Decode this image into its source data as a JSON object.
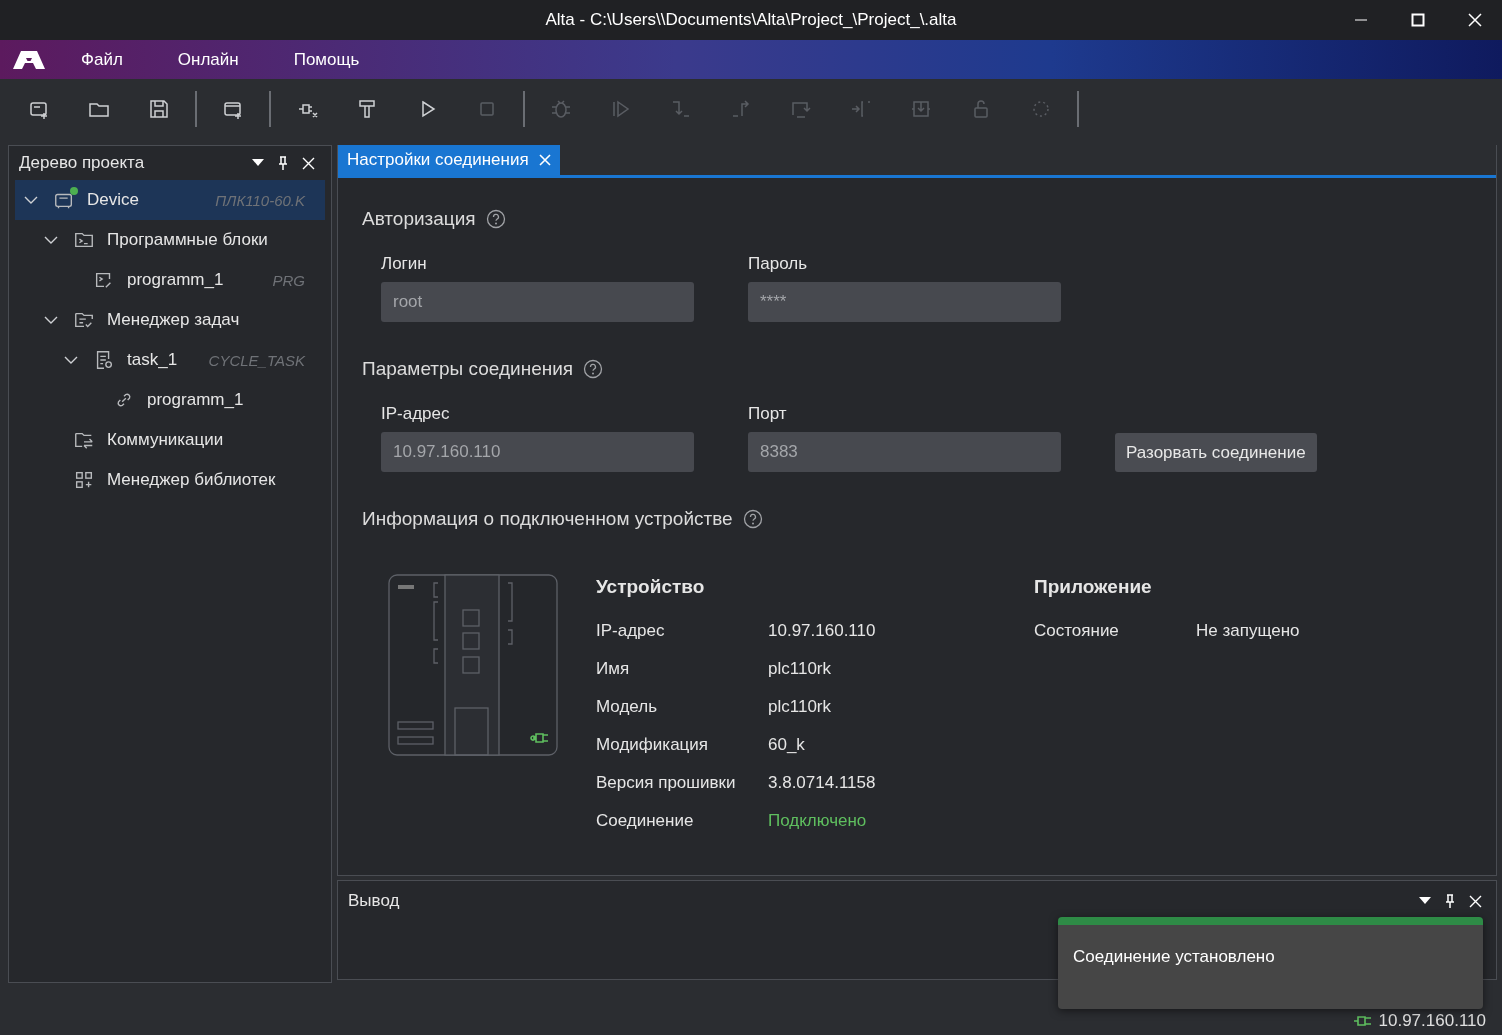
{
  "window": {
    "title": "Alta - C:\\Users\\\\Documents\\Alta\\Project_\\Project_\\.alta"
  },
  "menu": [
    "Файл",
    "Онлайн",
    "Помощь"
  ],
  "toolbar": [
    [
      {
        "disabled": false
      },
      {
        "disabled": false
      },
      {
        "disabled": false
      }
    ],
    [
      {
        "disabled": false
      }
    ],
    [
      {
        "disabled": false
      },
      {
        "disabled": false
      },
      {
        "disabled": false
      },
      {
        "disabled": true
      }
    ],
    [
      {
        "disabled": true
      },
      {
        "disabled": true
      },
      {
        "disabled": true
      },
      {
        "disabled": true
      },
      {
        "disabled": true
      },
      {
        "disabled": true
      },
      {
        "disabled": true
      },
      {
        "disabled": true
      },
      {
        "disabled": true
      }
    ]
  ],
  "project_tree": {
    "title": "Дерево проекта",
    "items": [
      {
        "kind": "device",
        "label": "Device",
        "type": "ПЛК110-60.K",
        "online": true,
        "selected": true,
        "expanded": true,
        "children": [
          {
            "kind": "blocks",
            "label": "Программные блоки",
            "selected": false,
            "expanded": true,
            "children": [
              {
                "kind": "program",
                "label": "programm_1",
                "type": "PRG",
                "selected": false
              }
            ]
          },
          {
            "kind": "tasks",
            "label": "Менеджер задач",
            "selected": false,
            "expanded": true,
            "children": [
              {
                "kind": "task",
                "label": "task_1",
                "type": "CYCLE_TASK",
                "selected": false,
                "expanded": true,
                "children": [
                  {
                    "kind": "link",
                    "label": "programm_1",
                    "selected": false
                  }
                ]
              }
            ]
          },
          {
            "kind": "comm",
            "label": "Коммуникации",
            "selected": false
          },
          {
            "kind": "library",
            "label": "Менеджер библиотек",
            "selected": false
          }
        ]
      }
    ]
  },
  "tabs": [
    {
      "label": "Настройки соединения",
      "selected": true
    }
  ],
  "auth": {
    "title": "Авторизация",
    "fields": [
      {
        "label": "Логин",
        "value": "root"
      },
      {
        "label": "Пароль",
        "value": "****"
      }
    ]
  },
  "connection": {
    "title": "Параметры соединения",
    "fields": [
      {
        "label": "IP-адрес",
        "value": "10.97.160.110"
      },
      {
        "label": "Порт",
        "value": "8383"
      }
    ],
    "button": "Разорвать соединение"
  },
  "device_info": {
    "title": "Информация о подключенном устройстве",
    "device": {
      "title": "Устройство",
      "rows": [
        {
          "kind": "text",
          "label": "IP-адрес",
          "value": "10.97.160.110"
        },
        {
          "kind": "text",
          "label": "Имя",
          "value": "plc110rk"
        },
        {
          "kind": "text",
          "label": "Модель",
          "value": "plc110rk"
        },
        {
          "kind": "text",
          "label": "Модификация",
          "value": "60_k"
        },
        {
          "kind": "text",
          "label": "Версия прошивки",
          "value": "3.8.0714.1158"
        },
        {
          "kind": "status",
          "label": "Соединение",
          "value": "Подключено"
        }
      ]
    },
    "application": {
      "title": "Приложение",
      "rows": [
        {
          "kind": "text",
          "label": "Состояние",
          "value": "Не запущено"
        }
      ]
    }
  },
  "output": {
    "title": "Вывод"
  },
  "toast": {
    "message": "Соединение установлено"
  },
  "status_bar": {
    "address": "10.97.160.110"
  }
}
